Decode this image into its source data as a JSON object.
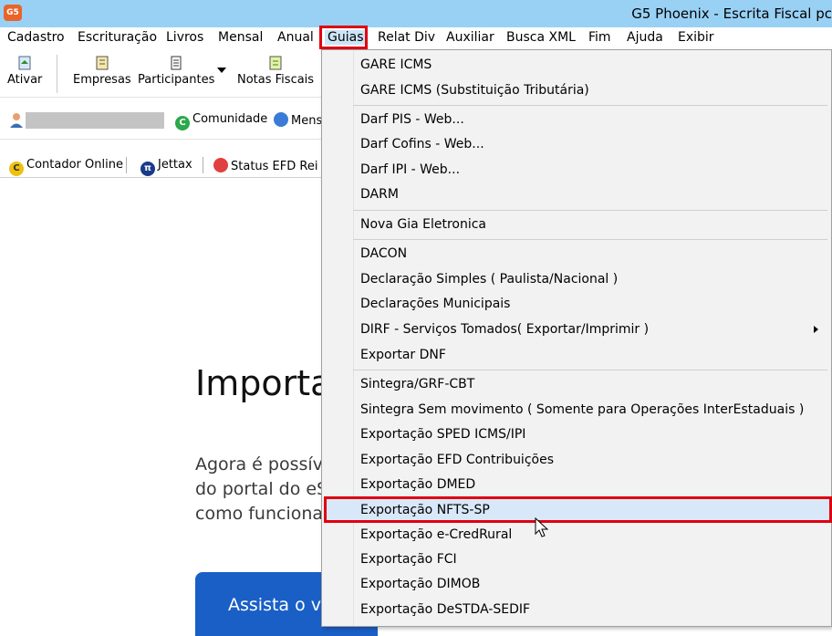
{
  "window": {
    "title": "G5 Phoenix - Escrita Fiscal pc",
    "logo_text": "G5"
  },
  "menubar": {
    "items": [
      "Cadastro",
      "Escrituração",
      "Livros",
      "Mensal",
      "Anual",
      "Guias",
      "Relat Div",
      "Auxiliar",
      "Busca XML",
      "Fim",
      "Ajuda",
      "Exibir"
    ],
    "active": "Guias"
  },
  "toolbar": {
    "ativar": "Ativar",
    "empresas": "Empresas",
    "participantes": "Participantes",
    "notas_fiscais": "Notas Fiscais"
  },
  "toolbar2": {
    "comunidade": "Comunidade",
    "mens": "Mens"
  },
  "toolbar3": {
    "contador_online": "Contador Online",
    "jettax": "Jettax",
    "status_efd": "Status EFD Rei"
  },
  "content": {
    "heading": "Importa",
    "para_line1": "Agora é possív",
    "para_line2": "do portal do eS",
    "para_line3": "como funciona",
    "cta_label": "Assista o v"
  },
  "guias_menu": {
    "items": [
      "GARE ICMS",
      "GARE ICMS (Substituição Tributária)",
      "Darf PIS - Web...",
      "Darf Cofins - Web...",
      "Darf IPI - Web...",
      "DARM",
      "Nova Gia Eletronica",
      "DACON",
      "Declaração Simples ( Paulista/Nacional )",
      "Declarações Municipais",
      "DIRF - Serviços Tomados( Exportar/Imprimir )",
      "Exportar DNF",
      "Sintegra/GRF-CBT",
      "Sintegra Sem movimento ( Somente para Operações InterEstaduais )",
      "Exportação SPED ICMS/IPI",
      "Exportação EFD Contribuições",
      "Exportação DMED",
      "Exportação NFTS-SP",
      "Exportação e-CredRural",
      "Exportação FCI",
      "Exportação DIMOB",
      "Exportação DeSTDA-SEDIF"
    ],
    "highlighted": "Exportação NFTS-SP",
    "submenu_item": "DIRF - Serviços Tomados( Exportar/Imprimir )"
  }
}
